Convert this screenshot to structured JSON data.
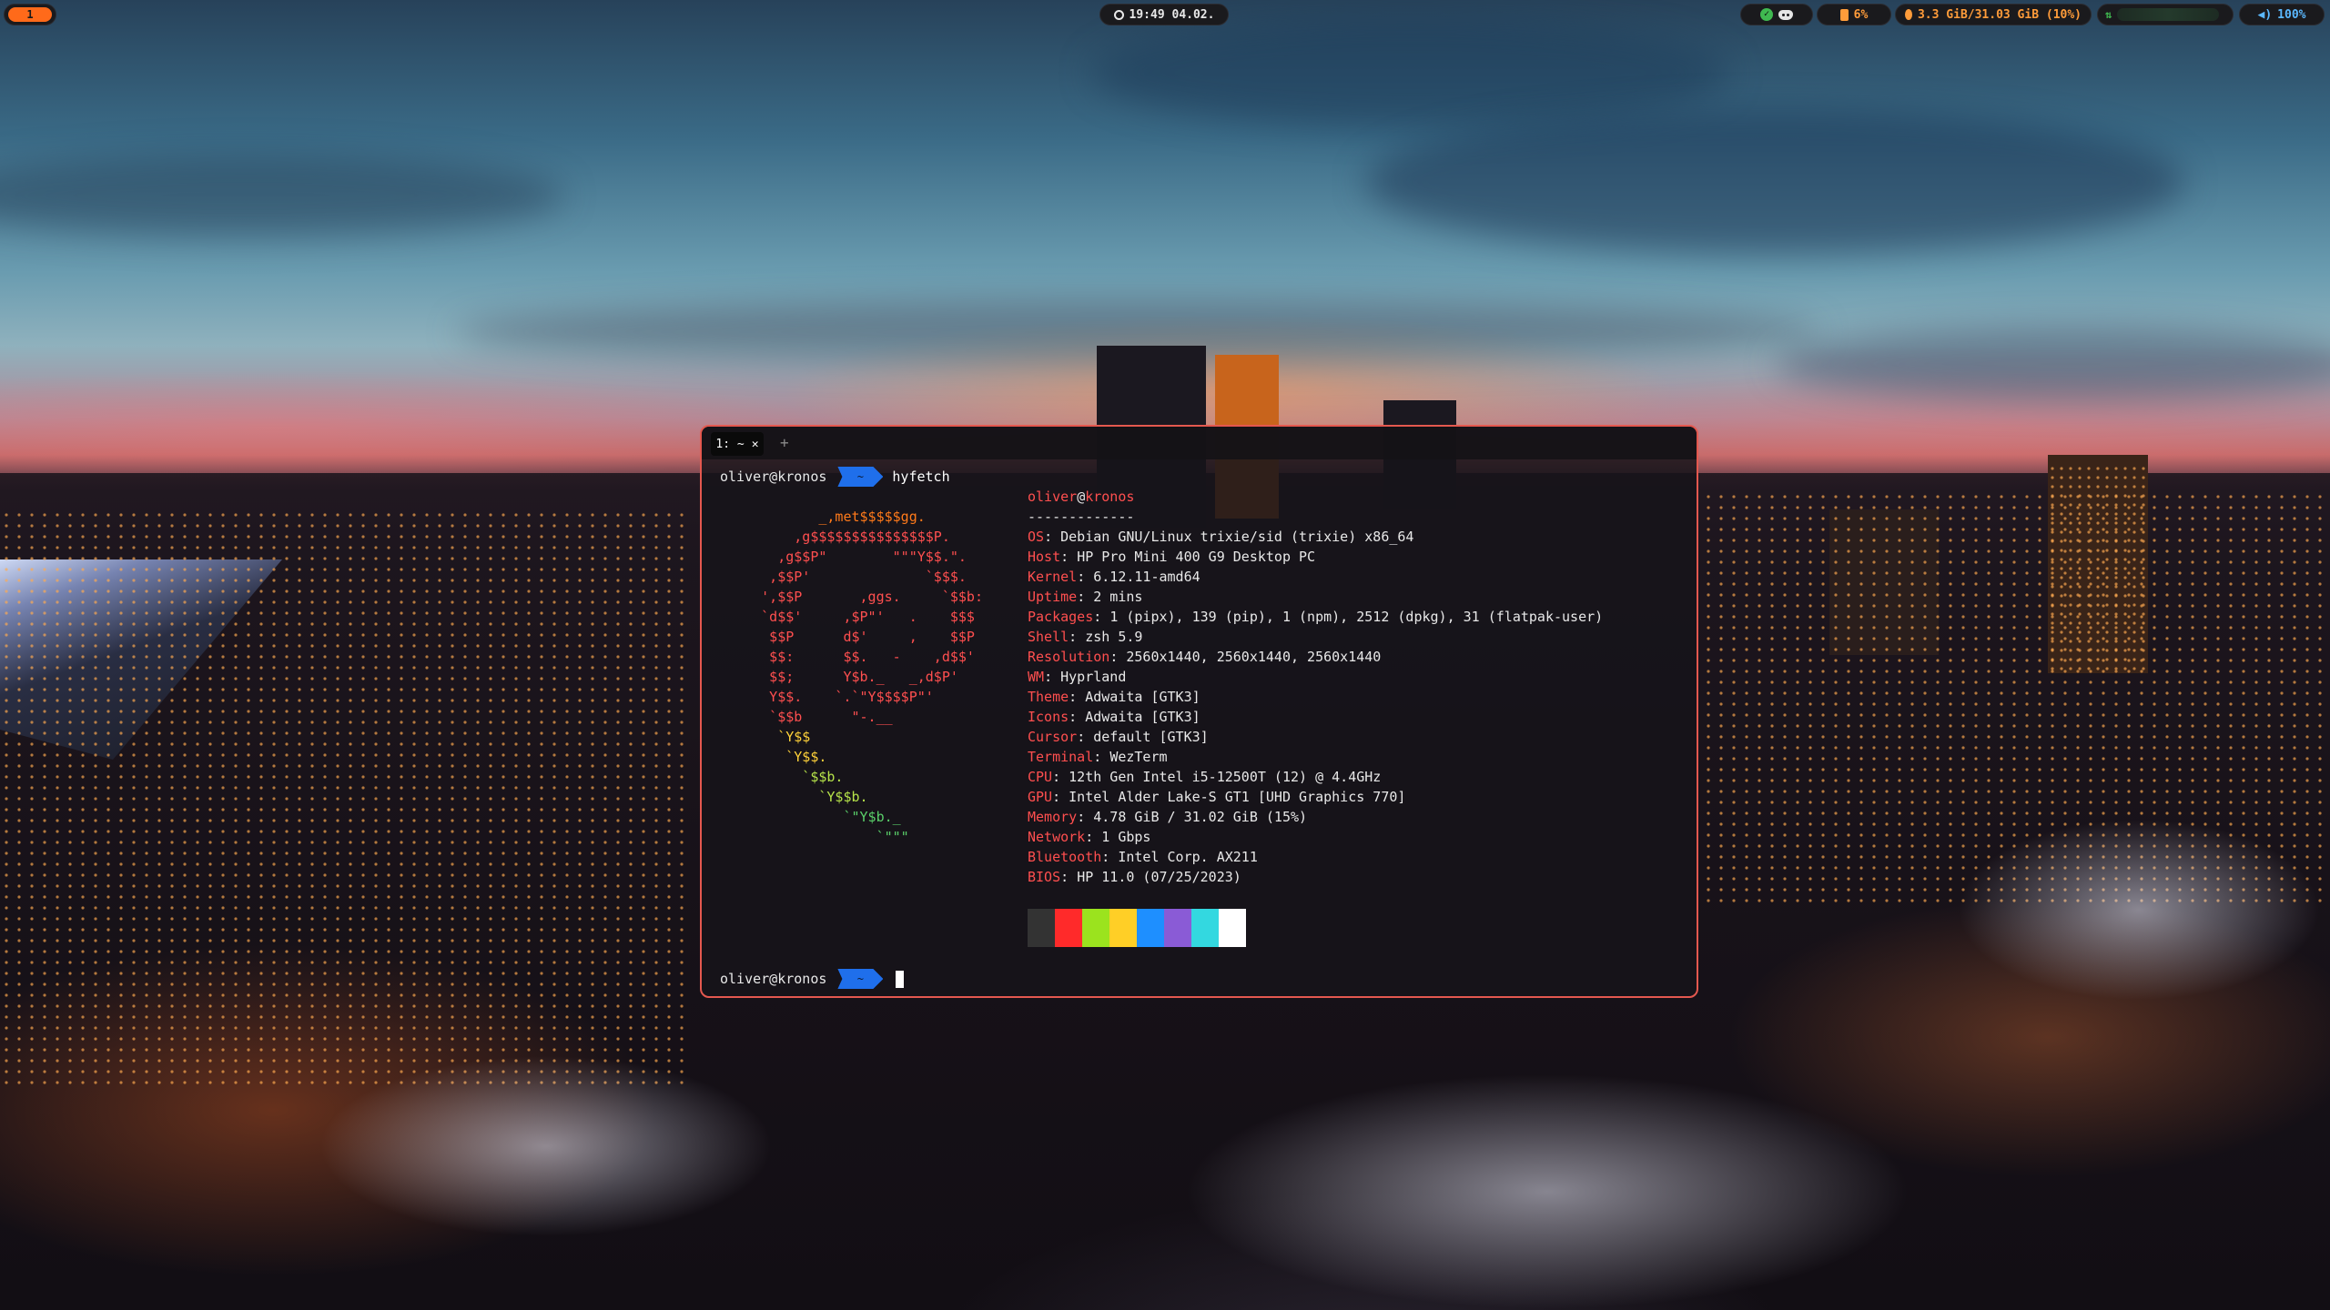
{
  "topbar": {
    "workspace": "1",
    "clock": "19:49 04.02.",
    "cpu": "6%",
    "memory": "3.3 GiB/31.03 GiB (10%)",
    "volume": "100%",
    "icons": [
      "check-icon",
      "discord-icon",
      "cpu-icon",
      "memory-icon",
      "network-icon",
      "speaker-icon",
      "clock-icon"
    ]
  },
  "terminal": {
    "tab_label": "1: ~",
    "tab_close": "✕",
    "new_tab": "+",
    "user_host": "oliver@kronos",
    "prompt_dir": "~",
    "command": "hyfetch",
    "fetch": {
      "title_user": "oliver",
      "title_at": "@",
      "title_host": "kronos",
      "separator": "-------------",
      "rows": [
        {
          "key": "OS",
          "value": "Debian GNU/Linux trixie/sid (trixie) x86_64"
        },
        {
          "key": "Host",
          "value": "HP Pro Mini 400 G9 Desktop PC"
        },
        {
          "key": "Kernel",
          "value": "6.12.11-amd64"
        },
        {
          "key": "Uptime",
          "value": "2 mins"
        },
        {
          "key": "Packages",
          "value": "1 (pipx), 139 (pip), 1 (npm), 2512 (dpkg), 31 (flatpak-user)"
        },
        {
          "key": "Shell",
          "value": "zsh 5.9"
        },
        {
          "key": "Resolution",
          "value": "2560x1440, 2560x1440, 2560x1440"
        },
        {
          "key": "WM",
          "value": "Hyprland"
        },
        {
          "key": "Theme",
          "value": "Adwaita [GTK3]"
        },
        {
          "key": "Icons",
          "value": "Adwaita [GTK3]"
        },
        {
          "key": "Cursor",
          "value": "default [GTK3]"
        },
        {
          "key": "Terminal",
          "value": "WezTerm"
        },
        {
          "key": "CPU",
          "value": "12th Gen Intel i5-12500T (12) @ 4.4GHz"
        },
        {
          "key": "GPU",
          "value": "Intel Alder Lake-S GT1 [UHD Graphics 770]"
        },
        {
          "key": "Memory",
          "value": "4.78 GiB / 31.02 GiB (15%)"
        },
        {
          "key": "Network",
          "value": "1 Gbps"
        },
        {
          "key": "Bluetooth",
          "value": "Intel Corp. AX211"
        },
        {
          "key": "BIOS",
          "value": "HP 11.0 (07/25/2023)"
        }
      ],
      "ascii_lines": [
        "            _,met$$$$$gg.",
        "         ,g$$$$$$$$$$$$$$$P.",
        "       ,g$$P\"        \"\"\"Y$$.\".",
        "      ,$$P'              `$$$.",
        "     ',$$P       ,ggs.     `$$b:",
        "     `d$$'     ,$P\"'   .    $$$",
        "      $$P      d$'     ,    $$P",
        "      $$:      $$.   -    ,d$$'",
        "      $$;      Y$b._   _,d$P'",
        "      Y$$.    `.`\"Y$$$$P\"'",
        "      `$$b      \"-.__",
        "       `Y$$",
        "        `Y$$.",
        "          `$$b.",
        "            `Y$$b.",
        "               `\"Y$b._",
        "                   `\"\"\""
      ],
      "ascii_colors": [
        "#ff7a1a",
        "#ff4f4f",
        "#ff4f4f",
        "#ff4f4f",
        "#ff4f4f",
        "#ff4f4f",
        "#ff4f4f",
        "#ff4f4f",
        "#ff4f4f",
        "#ff4f4f",
        "#ff4f4f",
        "#ffd23a",
        "#ffd23a",
        "#b6e34a",
        "#b6e34a",
        "#5ad06a",
        "#5ad06a"
      ],
      "palette": [
        "#333333",
        "#ff2a2a",
        "#9be31e",
        "#ffcf26",
        "#1e8fff",
        "#8a5bd6",
        "#33d8e0",
        "#ffffff"
      ]
    }
  }
}
